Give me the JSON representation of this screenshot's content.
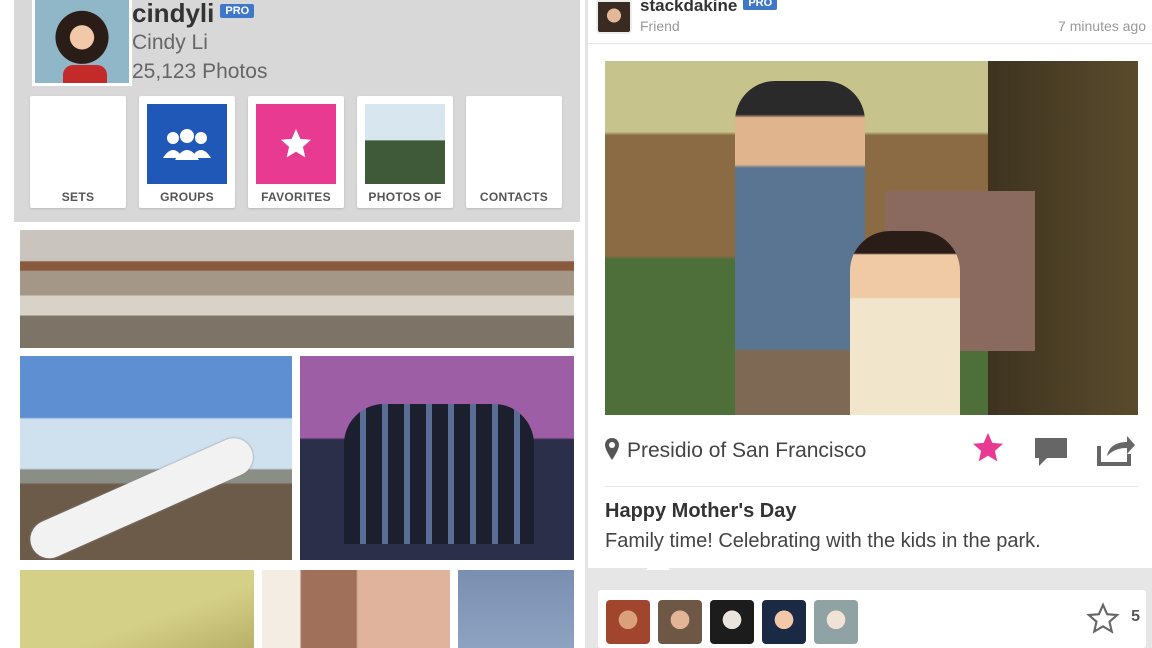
{
  "profile": {
    "username": "cindyli",
    "badge": "PRO",
    "real_name": "Cindy Li",
    "photo_count": "25,123 Photos"
  },
  "tiles": [
    {
      "label": "SETS",
      "icon": "sets-thumbnail"
    },
    {
      "label": "GROUPS",
      "icon": "groups-icon"
    },
    {
      "label": "FAVORITES",
      "icon": "star-icon"
    },
    {
      "label": "PHOTOS OF",
      "icon": "photos-of-thumbnail"
    },
    {
      "label": "CONTACTS",
      "icon": "contacts-thumbnail"
    }
  ],
  "post": {
    "username": "stackdakine",
    "badge": "PRO",
    "relationship": "Friend",
    "time": "7 minutes ago",
    "location": "Presidio of San Francisco",
    "title": "Happy Mother's Day",
    "description": "Family time! Celebrating with the kids in the park.",
    "fave_count": "5"
  },
  "colors": {
    "accent_blue": "#1f58b6",
    "accent_pink": "#e93a92",
    "pro_badge": "#3f78c9"
  }
}
